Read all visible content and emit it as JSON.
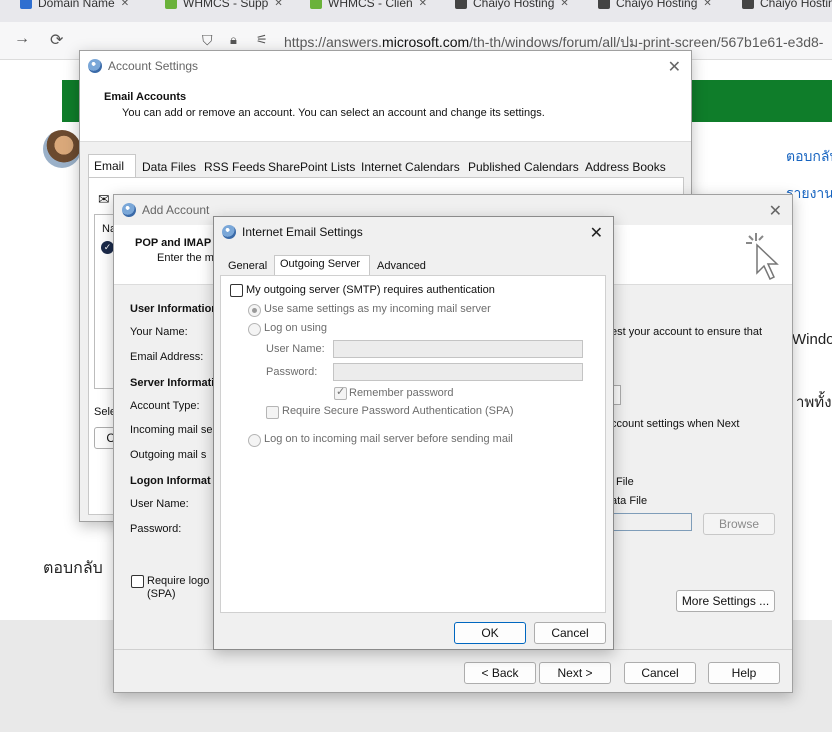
{
  "browser": {
    "tabs": [
      {
        "label": "Domain Name",
        "color": "#2f6fd0"
      },
      {
        "label": "WHMCS - Supp",
        "color": "#6ab23a"
      },
      {
        "label": "WHMCS - Clien",
        "color": "#6ab23a"
      },
      {
        "label": "Chaiyo Hosting",
        "color": "#444444"
      },
      {
        "label": "Chaiyo Hosting",
        "color": "#444444"
      },
      {
        "label": "Chaiyo Hosting",
        "color": "#444444"
      }
    ],
    "url_prefix": "https://answers.",
    "url_domain": "microsoft.com",
    "url_path": "/th-th/windows/forum/all/ปม-print-screen/567b1e61-e3d8-"
  },
  "page": {
    "side_link_1": "ตอบกลับ",
    "side_link_2": "รายงาน",
    "side_text_windows": "Window",
    "side_text_thai": "าพทั้งห",
    "reply_label": "ตอบกลับ"
  },
  "account_settings": {
    "title": "Account Settings",
    "header_title": "Email Accounts",
    "header_desc": "You can add or remove an account. You can select an account and change its settings.",
    "tabs": [
      "Email",
      "Data Files",
      "RSS Feeds",
      "SharePoint Lists",
      "Internet Calendars",
      "Published Calendars",
      "Address Books"
    ],
    "toolbar_fragment": "N",
    "name_col_fragment": "Na",
    "sel_fragment": "Sele",
    "ch_fragment": "Ch"
  },
  "add_account": {
    "title": "Add Account",
    "heading": "POP and IMAP",
    "subheading": "Enter the m",
    "user_info": "User Information",
    "your_name": "Your Name:",
    "email_address": "Email Address:",
    "server_info": "Server Informati",
    "account_type": "Account Type:",
    "incoming": "Incoming mail se",
    "outgoing": "Outgoing mail s",
    "logon_info": "Logon Informat",
    "user_name": "User Name:",
    "password": "Password:",
    "require_logon": "Require logo",
    "spa": "(SPA)",
    "test_text": "est your account to ensure that",
    "next_text": "ccount settings when Next",
    "file_text": "File",
    "data_file_text": "ata File",
    "browse": "Browse",
    "more_settings": "More Settings ...",
    "back": "< Back",
    "next": "Next >",
    "cancel": "Cancel",
    "help": "Help"
  },
  "internet_email": {
    "title": "Internet Email Settings",
    "tabs": [
      "General",
      "Outgoing Server",
      "Advanced"
    ],
    "active_tab": "Outgoing Server",
    "smtp_auth": "My outgoing server (SMTP) requires authentication",
    "use_same": "Use same settings as my incoming mail server",
    "log_on_using": "Log on using",
    "user_name": "User Name:",
    "password": "Password:",
    "remember_password": "Remember password",
    "require_spa": "Require Secure Password Authentication (SPA)",
    "log_on_incoming": "Log on to incoming mail server before sending mail",
    "ok": "OK",
    "cancel": "Cancel"
  }
}
